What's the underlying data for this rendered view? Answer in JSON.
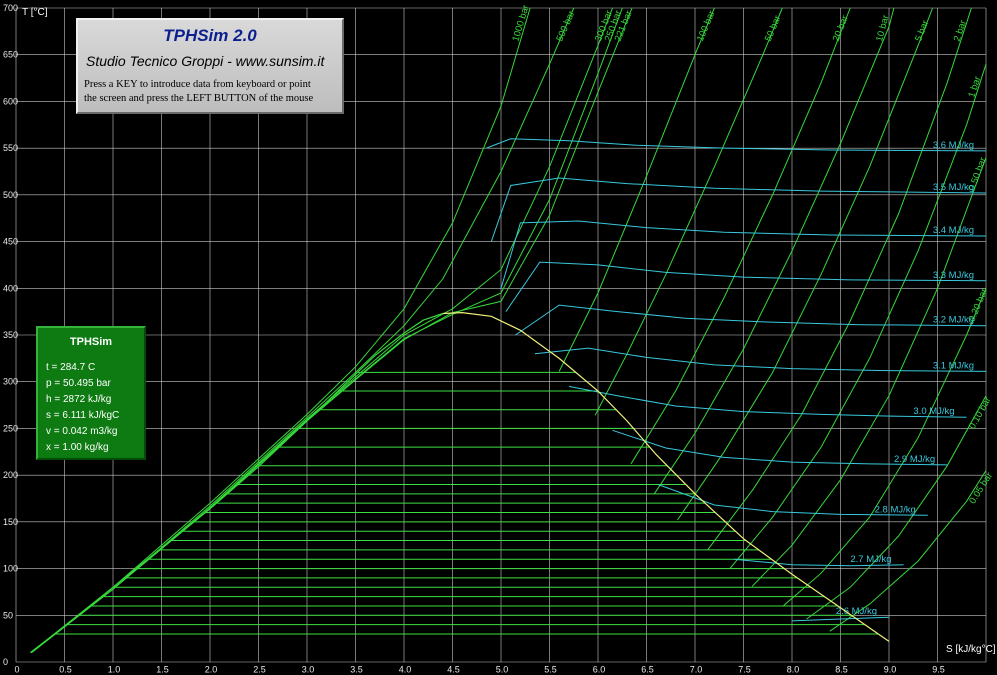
{
  "colors": {
    "background": "#000000",
    "grid": "#c8c8c8",
    "isobar": "#36d83a",
    "isenthalpic": "#38c8dc",
    "saturation": "#f0f07a",
    "quality_lines": "#3ce042",
    "panel_green": "#0e7a12"
  },
  "title_box": {
    "title": "TPHSim 2.0",
    "subtitle": "Studio Tecnico Groppi - www.sunsim.it",
    "instruction_line1": "Press a KEY to introduce data from keyboard or point",
    "instruction_line2": "the screen and press the LEFT BUTTON of the mouse"
  },
  "state_box": {
    "header": "TPHSim",
    "t": "t = 284.7 C",
    "p": "p = 50.495 bar",
    "h": "h = 2872 kJ/kg",
    "s": "s = 6.111 kJ/kgC",
    "v": "v = 0.042 m3/kg",
    "x": "x = 1.00 kg/kg"
  },
  "chart_data": {
    "type": "line",
    "xlabel": "S [kJ/kg°C]",
    "ylabel": "T [°C]",
    "xlim": [
      0,
      10
    ],
    "ylim": [
      0,
      700
    ],
    "x_ticks": [
      "0",
      "0.5",
      "1.0",
      "1.5",
      "2.0",
      "2.5",
      "3.0",
      "3.5",
      "4.0",
      "4.5",
      "5.0",
      "5.5",
      "6.0",
      "6.5",
      "7.0",
      "7.5",
      "8.0",
      "8.5",
      "9.0",
      "9.5"
    ],
    "x_tick_values": [
      0,
      0.5,
      1.0,
      1.5,
      2.0,
      2.5,
      3.0,
      3.5,
      4.0,
      4.5,
      5.0,
      5.5,
      6.0,
      6.5,
      7.0,
      7.5,
      8.0,
      8.5,
      9.0,
      9.5
    ],
    "y_ticks": [
      "0",
      "50",
      "100",
      "150",
      "200",
      "250",
      "300",
      "350",
      "400",
      "450",
      "500",
      "550",
      "600",
      "650",
      "700"
    ],
    "y_tick_values": [
      0,
      50,
      100,
      150,
      200,
      250,
      300,
      350,
      400,
      450,
      500,
      550,
      600,
      650,
      700
    ],
    "grid": true,
    "saturation_dome": {
      "liquid": [
        [
          0.15,
          10
        ],
        [
          0.5,
          38
        ],
        [
          1.0,
          80
        ],
        [
          1.5,
          122
        ],
        [
          2.0,
          164
        ],
        [
          2.5,
          209
        ],
        [
          3.0,
          258
        ],
        [
          3.4,
          298
        ],
        [
          3.7,
          328
        ],
        [
          4.0,
          352
        ],
        [
          4.2,
          366
        ],
        [
          4.4,
          373
        ]
      ],
      "vapor": [
        [
          4.4,
          373
        ],
        [
          4.6,
          374
        ],
        [
          4.9,
          370
        ],
        [
          5.2,
          355
        ],
        [
          5.6,
          325
        ],
        [
          6.0,
          290
        ],
        [
          6.3,
          258
        ],
        [
          6.6,
          222
        ],
        [
          7.0,
          180
        ],
        [
          7.5,
          132
        ],
        [
          8.0,
          94
        ],
        [
          8.5,
          58
        ],
        [
          9.0,
          22
        ]
      ]
    },
    "isobars": [
      {
        "name": "1000 bar",
        "points": [
          [
            0.2,
            14
          ],
          [
            1.0,
            80
          ],
          [
            2.0,
            170
          ],
          [
            3.0,
            265
          ],
          [
            3.5,
            316
          ],
          [
            4.0,
            378
          ],
          [
            4.5,
            470
          ],
          [
            5.0,
            595
          ],
          [
            5.3,
            700
          ]
        ]
      },
      {
        "name": "500 bar",
        "points": [
          [
            0.18,
            12
          ],
          [
            1.0,
            78
          ],
          [
            2.0,
            167
          ],
          [
            3.0,
            262
          ],
          [
            3.5,
            310
          ],
          [
            4.0,
            360
          ],
          [
            4.4,
            410
          ],
          [
            5.0,
            525
          ],
          [
            5.5,
            640
          ],
          [
            5.75,
            700
          ]
        ]
      },
      {
        "name": "300 bar",
        "points": [
          [
            0.16,
            11
          ],
          [
            1.0,
            78
          ],
          [
            2.0,
            165
          ],
          [
            3.0,
            260
          ],
          [
            3.5,
            305
          ],
          [
            4.0,
            350
          ],
          [
            4.5,
            378
          ],
          [
            5.0,
            420
          ],
          [
            5.5,
            530
          ],
          [
            6.0,
            660
          ],
          [
            6.15,
            700
          ]
        ]
      },
      {
        "name": "250 bar",
        "points": [
          [
            0.16,
            10
          ],
          [
            1.0,
            78
          ],
          [
            2.0,
            165
          ],
          [
            3.0,
            259
          ],
          [
            3.5,
            303
          ],
          [
            4.0,
            346
          ],
          [
            4.5,
            372
          ],
          [
            5.0,
            395
          ],
          [
            5.5,
            495
          ],
          [
            6.0,
            630
          ],
          [
            6.25,
            700
          ]
        ]
      },
      {
        "name": "221 bar",
        "points": [
          [
            0.15,
            10
          ],
          [
            1.0,
            78
          ],
          [
            2.0,
            164
          ],
          [
            3.0,
            258
          ],
          [
            3.5,
            302
          ],
          [
            4.0,
            345
          ],
          [
            4.5,
            374
          ],
          [
            5.0,
            386
          ],
          [
            5.5,
            478
          ],
          [
            6.0,
            610
          ],
          [
            6.35,
            700
          ]
        ]
      },
      {
        "name": "100 bar",
        "points": [
          [
            5.6,
            311
          ],
          [
            6.0,
            395
          ],
          [
            6.5,
            520
          ],
          [
            7.0,
            650
          ],
          [
            7.2,
            700
          ]
        ]
      },
      {
        "name": "50 bar",
        "points": [
          [
            5.97,
            264
          ],
          [
            6.3,
            330
          ],
          [
            6.7,
            415
          ],
          [
            7.2,
            530
          ],
          [
            7.7,
            650
          ],
          [
            7.9,
            700
          ]
        ]
      },
      {
        "name": "20 bar",
        "points": [
          [
            6.34,
            212
          ],
          [
            6.8,
            290
          ],
          [
            7.3,
            390
          ],
          [
            7.8,
            500
          ],
          [
            8.3,
            620
          ],
          [
            8.6,
            700
          ]
        ]
      },
      {
        "name": "10 bar",
        "points": [
          [
            6.58,
            180
          ],
          [
            7.0,
            245
          ],
          [
            7.5,
            335
          ],
          [
            8.0,
            440
          ],
          [
            8.5,
            555
          ],
          [
            9.0,
            680
          ],
          [
            9.05,
            700
          ]
        ]
      },
      {
        "name": "5 bar",
        "points": [
          [
            6.82,
            152
          ],
          [
            7.3,
            225
          ],
          [
            7.8,
            310
          ],
          [
            8.3,
            415
          ],
          [
            8.8,
            530
          ],
          [
            9.3,
            660
          ],
          [
            9.45,
            700
          ]
        ]
      },
      {
        "name": "2 bar",
        "points": [
          [
            7.13,
            120
          ],
          [
            7.6,
            185
          ],
          [
            8.1,
            265
          ],
          [
            8.6,
            365
          ],
          [
            9.1,
            480
          ],
          [
            9.6,
            620
          ],
          [
            9.85,
            700
          ]
        ]
      },
      {
        "name": "1 bar",
        "points": [
          [
            7.36,
            100
          ],
          [
            7.8,
            155
          ],
          [
            8.3,
            230
          ],
          [
            8.8,
            325
          ],
          [
            9.3,
            440
          ],
          [
            9.8,
            575
          ],
          [
            10.0,
            640
          ]
        ]
      },
      {
        "name": "0.50 bar",
        "points": [
          [
            7.59,
            81
          ],
          [
            8.0,
            125
          ],
          [
            8.5,
            195
          ],
          [
            9.0,
            285
          ],
          [
            9.5,
            400
          ],
          [
            10.0,
            540
          ]
        ]
      },
      {
        "name": "0.20 bar",
        "points": [
          [
            7.91,
            60
          ],
          [
            8.3,
            95
          ],
          [
            8.8,
            155
          ],
          [
            9.3,
            240
          ],
          [
            9.8,
            350
          ],
          [
            10.0,
            400
          ]
        ]
      },
      {
        "name": "0.10 bar",
        "points": [
          [
            8.15,
            46
          ],
          [
            8.6,
            80
          ],
          [
            9.1,
            135
          ],
          [
            9.6,
            210
          ],
          [
            10.0,
            285
          ]
        ]
      },
      {
        "name": "0.05 bar",
        "points": [
          [
            8.39,
            33
          ],
          [
            8.8,
            62
          ],
          [
            9.3,
            108
          ],
          [
            9.8,
            172
          ],
          [
            10.0,
            205
          ]
        ]
      }
    ],
    "isenthalps": [
      {
        "name": "2.6 MJ/kg",
        "points": [
          [
            8.0,
            44
          ],
          [
            8.5,
            46
          ],
          [
            9.0,
            48
          ]
        ]
      },
      {
        "name": "2.7 MJ/kg",
        "points": [
          [
            7.4,
            110
          ],
          [
            8.0,
            104
          ],
          [
            8.6,
            103
          ],
          [
            9.15,
            104
          ]
        ]
      },
      {
        "name": "2.8 MJ/kg",
        "points": [
          [
            6.62,
            190
          ],
          [
            7.2,
            168
          ],
          [
            7.8,
            161
          ],
          [
            8.5,
            158
          ],
          [
            9.4,
            157
          ]
        ]
      },
      {
        "name": "2.9 MJ/kg",
        "points": [
          [
            6.15,
            248
          ],
          [
            6.7,
            229
          ],
          [
            7.3,
            219
          ],
          [
            8.0,
            214
          ],
          [
            8.8,
            212
          ],
          [
            9.6,
            211
          ]
        ]
      },
      {
        "name": "3.0 MJ/kg",
        "points": [
          [
            5.7,
            295
          ],
          [
            6.2,
            285
          ],
          [
            6.8,
            274
          ],
          [
            7.5,
            268
          ],
          [
            8.3,
            265
          ],
          [
            9.1,
            263
          ],
          [
            9.8,
            262
          ]
        ]
      },
      {
        "name": "3.1 MJ/kg",
        "points": [
          [
            5.35,
            330
          ],
          [
            5.9,
            336
          ],
          [
            6.5,
            326
          ],
          [
            7.2,
            318
          ],
          [
            8.0,
            314
          ],
          [
            8.9,
            312
          ],
          [
            10.0,
            311
          ]
        ]
      },
      {
        "name": "3.2 MJ/kg",
        "points": [
          [
            5.15,
            350
          ],
          [
            5.6,
            382
          ],
          [
            6.2,
            375
          ],
          [
            6.9,
            368
          ],
          [
            7.7,
            364
          ],
          [
            8.7,
            361
          ],
          [
            10.0,
            360
          ]
        ]
      },
      {
        "name": "3.3 MJ/kg",
        "points": [
          [
            5.05,
            375
          ],
          [
            5.4,
            428
          ],
          [
            6.0,
            425
          ],
          [
            6.7,
            417
          ],
          [
            7.5,
            412
          ],
          [
            8.6,
            409
          ],
          [
            10.0,
            408
          ]
        ]
      },
      {
        "name": "3.4 MJ/kg",
        "points": [
          [
            5.0,
            400
          ],
          [
            5.2,
            470
          ],
          [
            5.8,
            472
          ],
          [
            6.5,
            465
          ],
          [
            7.3,
            460
          ],
          [
            8.4,
            457
          ],
          [
            10.0,
            456
          ]
        ]
      },
      {
        "name": "3.5 MJ/kg",
        "points": [
          [
            4.9,
            450
          ],
          [
            5.1,
            510
          ],
          [
            5.6,
            518
          ],
          [
            6.3,
            512
          ],
          [
            7.2,
            507
          ],
          [
            8.3,
            504
          ],
          [
            10.0,
            502
          ]
        ]
      },
      {
        "name": "3.6 MJ/kg",
        "points": [
          [
            4.85,
            550
          ],
          [
            5.1,
            560
          ],
          [
            5.7,
            558
          ],
          [
            6.4,
            553
          ],
          [
            7.3,
            550
          ],
          [
            8.4,
            548
          ],
          [
            10.0,
            547
          ]
        ]
      }
    ],
    "quality_lines_T": [
      20,
      30,
      40,
      50,
      60,
      70,
      80,
      90,
      100,
      110,
      120,
      130,
      140,
      150,
      160,
      170,
      180,
      190,
      200,
      210,
      230,
      250,
      270,
      290,
      310
    ]
  }
}
